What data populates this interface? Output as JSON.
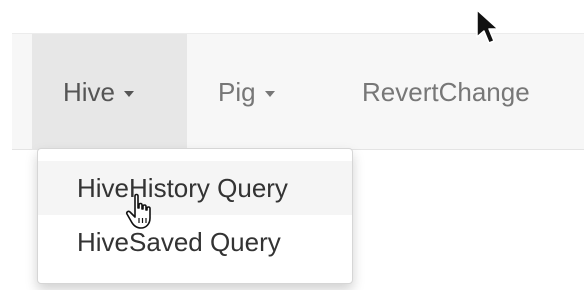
{
  "navbar": {
    "items": [
      {
        "label": "Hive",
        "has_caret": true,
        "active": true
      },
      {
        "label": "Pig",
        "has_caret": true,
        "active": false
      },
      {
        "label": "RevertChange",
        "has_caret": false,
        "active": false
      }
    ]
  },
  "dropdown": {
    "items": [
      {
        "label": "HiveHistory Query",
        "hovered": true
      },
      {
        "label": "HiveSaved Query",
        "hovered": false
      }
    ]
  },
  "icons": {
    "caret": "caret-down-icon",
    "pointer": "arrow-cursor-icon",
    "hand": "hand-cursor-icon"
  },
  "colors": {
    "navbar_bg": "#f7f7f7",
    "active_bg": "#e7e7e7",
    "text_muted": "#777777",
    "text_dark": "#333333"
  }
}
